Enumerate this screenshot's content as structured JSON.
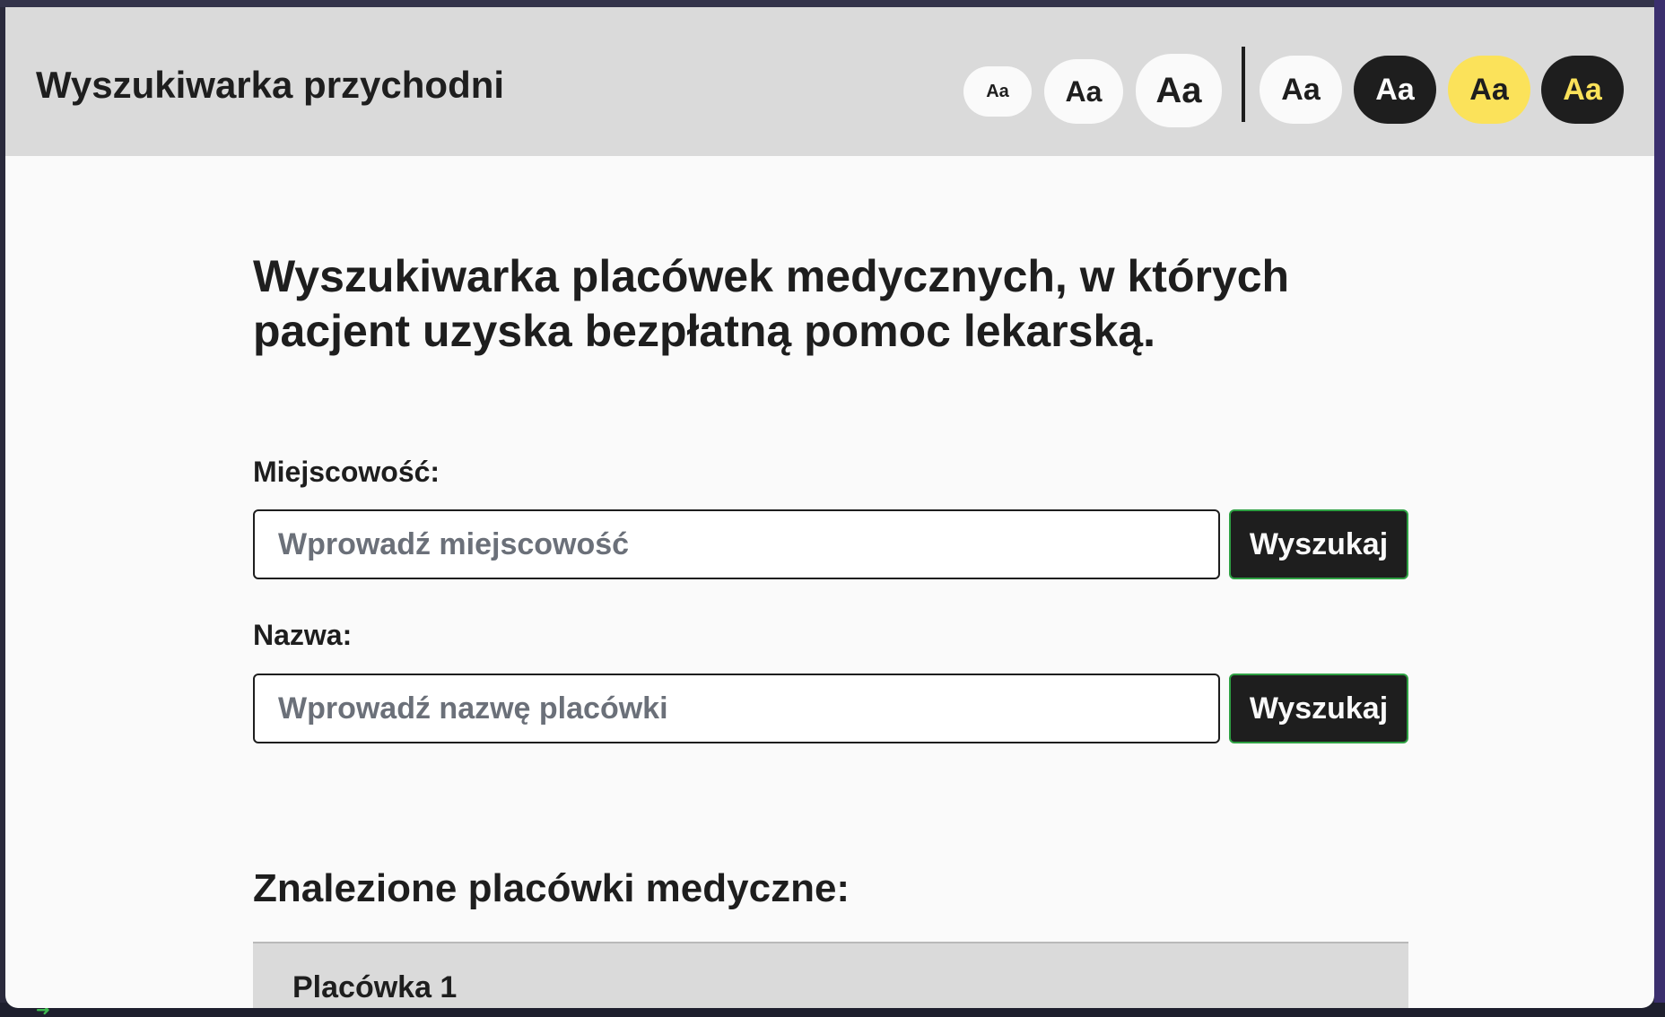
{
  "header": {
    "title": "Wyszukiwarka przychodni",
    "font_size_buttons": [
      {
        "label": "Aa",
        "size": "small"
      },
      {
        "label": "Aa",
        "size": "medium"
      },
      {
        "label": "Aa",
        "size": "large"
      }
    ],
    "contrast_buttons": [
      {
        "label": "Aa",
        "theme": "light"
      },
      {
        "label": "Aa",
        "theme": "dark"
      },
      {
        "label": "Aa",
        "theme": "yellow"
      },
      {
        "label": "Aa",
        "theme": "dark-yellow"
      }
    ]
  },
  "main": {
    "intro": "Wyszukiwarka placówek medycznych, w których pacjent uzyska bezpłatną pomoc lekarską.",
    "city": {
      "label": "Miejscowość:",
      "placeholder": "Wprowadź miejscowość",
      "value": "",
      "button": "Wyszukaj"
    },
    "name": {
      "label": "Nazwa:",
      "placeholder": "Wprowadź nazwę placówki",
      "value": "",
      "button": "Wyszukaj"
    },
    "results_heading": "Znalezione placówki medyczne:",
    "results": [
      {
        "title": "Placówka 1"
      }
    ]
  },
  "colors": {
    "background": "#fafafa",
    "header_bg": "#dadada",
    "text": "#1e1e1e",
    "accent_yellow": "#fbe25a",
    "button_border": "#2ea043"
  }
}
